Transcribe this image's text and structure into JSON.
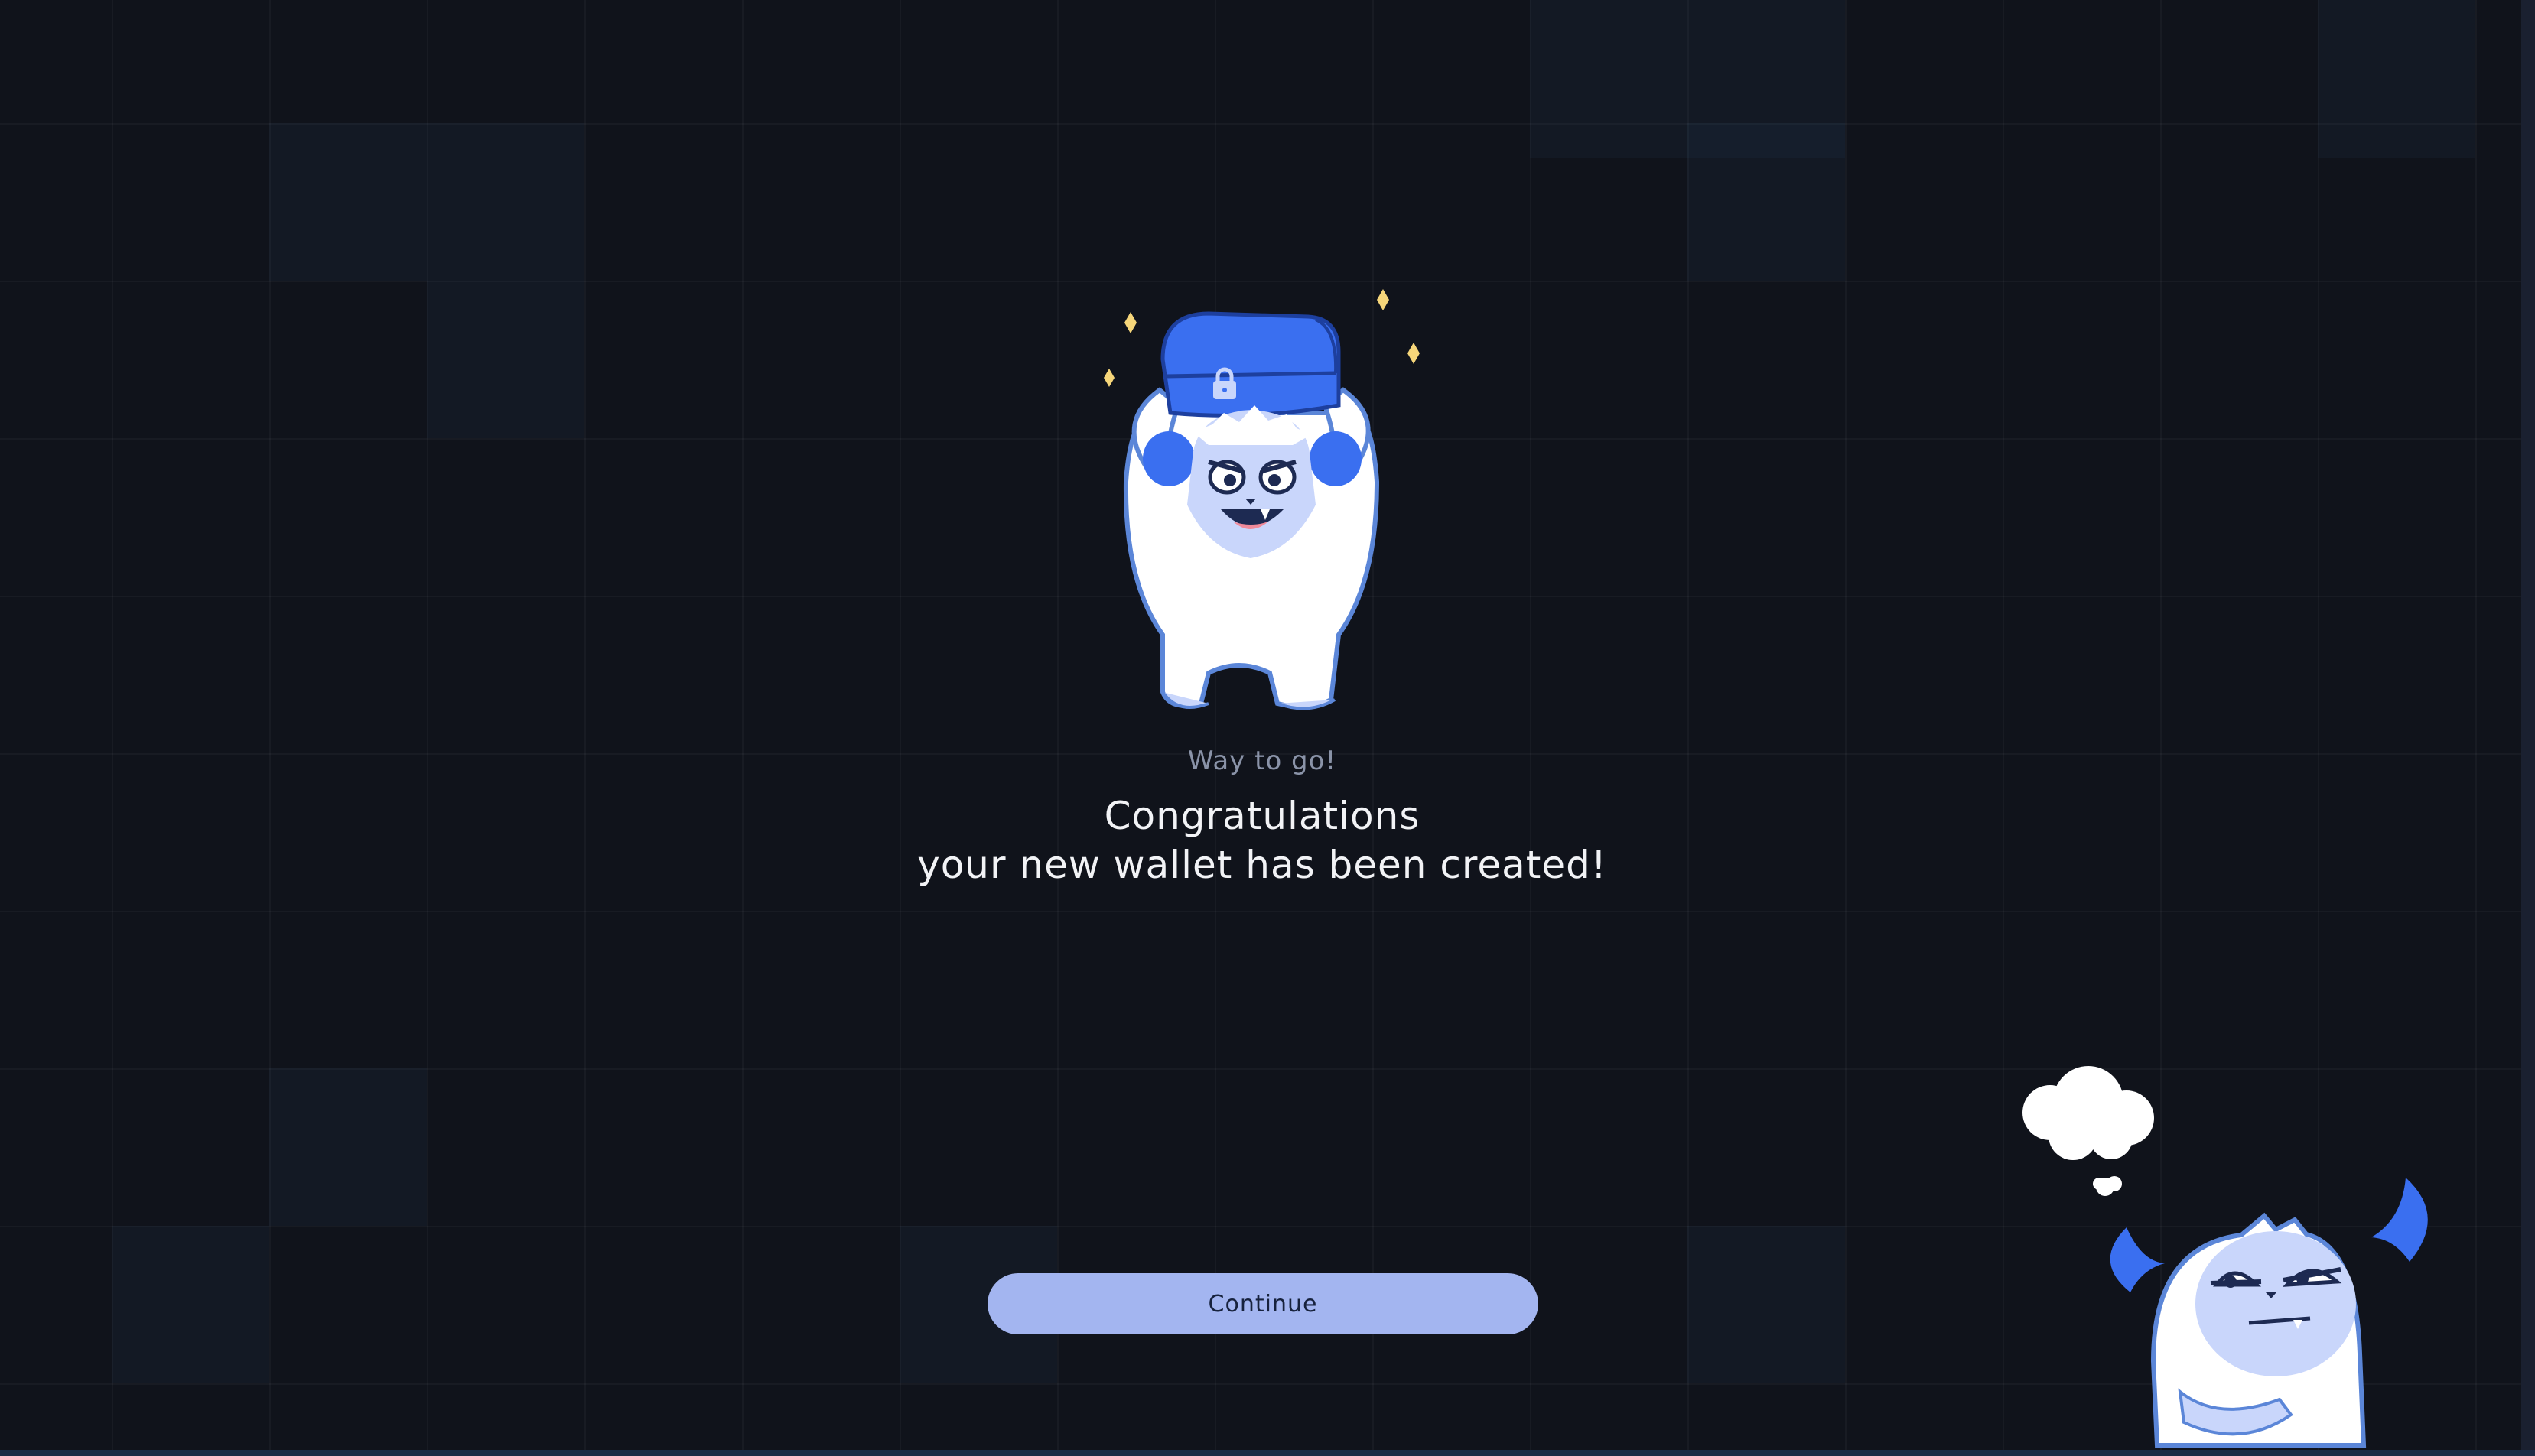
{
  "onboarding": {
    "eyebrow": "Way to go!",
    "title_line1": "Congratulations",
    "title_line2": "your new wallet has been created!",
    "continue_label": "Continue"
  },
  "colors": {
    "background": "#10131b",
    "button_bg": "#a3b5f0",
    "button_text": "#17223d",
    "heading_text": "#f2f3f6",
    "eyebrow_text": "#8a93a8",
    "mascot_blue": "#3a6ff0",
    "mascot_light": "#c9d6fb"
  },
  "illustrations": {
    "hero": "yeti-holding-locked-chest-icon",
    "corner": "thinking-yeti-icon"
  }
}
